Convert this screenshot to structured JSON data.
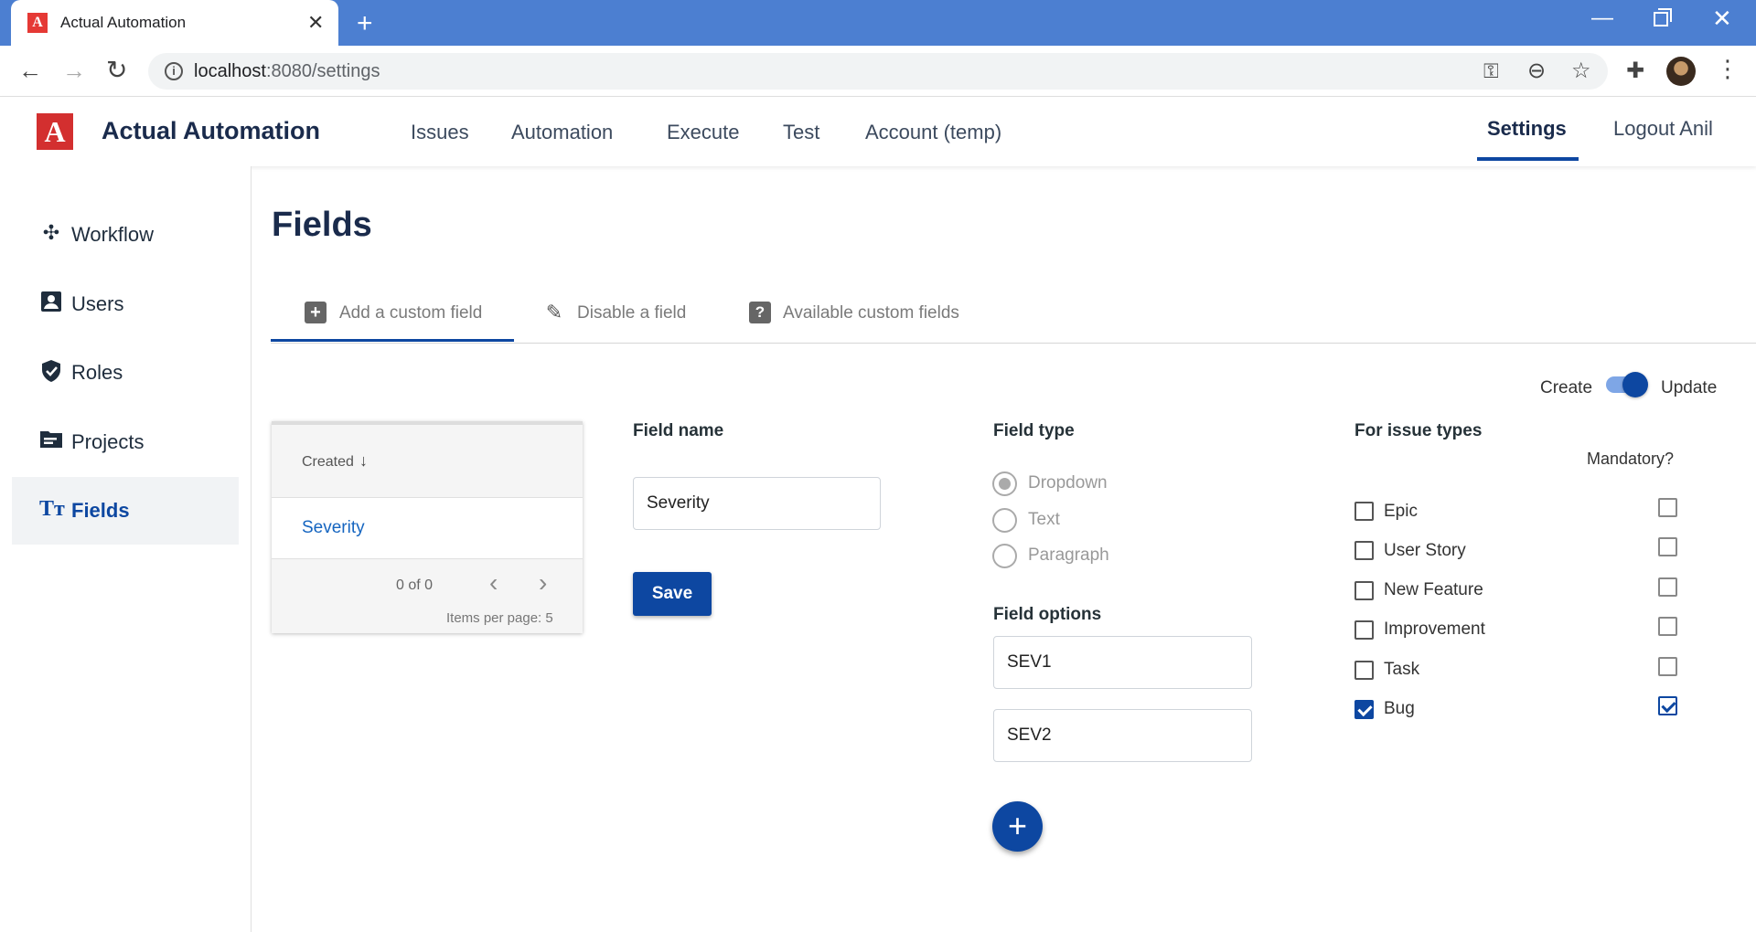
{
  "browser": {
    "tab_title": "Actual Automation",
    "url_host": "localhost",
    "url_path": ":8080/settings"
  },
  "header": {
    "logo_letter": "A",
    "brand": "Actual Automation",
    "nav": [
      "Issues",
      "Automation",
      "Execute",
      "Test",
      "Account (temp)"
    ],
    "active": "Settings",
    "logout": "Logout Anil"
  },
  "sidebar": {
    "items": [
      {
        "label": "Workflow",
        "icon": "workflow-icon",
        "active": false
      },
      {
        "label": "Users",
        "icon": "user-icon",
        "active": false
      },
      {
        "label": "Roles",
        "icon": "shield-icon",
        "active": false
      },
      {
        "label": "Projects",
        "icon": "folder-icon",
        "active": false
      },
      {
        "label": "Fields",
        "icon": "text-icon",
        "active": true
      }
    ]
  },
  "page": {
    "title": "Fields",
    "tabs": [
      {
        "label": "Add a custom field",
        "icon": "add-box-icon",
        "active": true
      },
      {
        "label": "Disable a field",
        "icon": "pencil-icon",
        "active": false
      },
      {
        "label": "Available custom fields",
        "icon": "help-box-icon",
        "active": false
      }
    ],
    "mode": {
      "left": "Create",
      "right": "Update",
      "selected": "Update"
    }
  },
  "table": {
    "column": "Created",
    "rows": [
      "Severity"
    ],
    "range": "0 of 0",
    "per_page_label": "Items per page:",
    "per_page_value": "5"
  },
  "field_name": {
    "label": "Field name",
    "value": "Severity",
    "save_label": "Save"
  },
  "field_type": {
    "label": "Field type",
    "options": [
      "Dropdown",
      "Text",
      "Paragraph"
    ],
    "selected": "Dropdown"
  },
  "field_options": {
    "label": "Field options",
    "values": [
      "SEV1",
      "SEV2"
    ]
  },
  "issue_types": {
    "label": "For issue types",
    "mandatory_label": "Mandatory?",
    "items": [
      {
        "label": "Epic",
        "checked": false,
        "mandatory": false
      },
      {
        "label": "User Story",
        "checked": false,
        "mandatory": false
      },
      {
        "label": "New Feature",
        "checked": false,
        "mandatory": false
      },
      {
        "label": "Improvement",
        "checked": false,
        "mandatory": false
      },
      {
        "label": "Task",
        "checked": false,
        "mandatory": false
      },
      {
        "label": "Bug",
        "checked": true,
        "mandatory": true
      }
    ]
  },
  "colors": {
    "accent": "#0d47a1",
    "chrome": "#4c7fd1",
    "logo": "#d32f2f"
  }
}
